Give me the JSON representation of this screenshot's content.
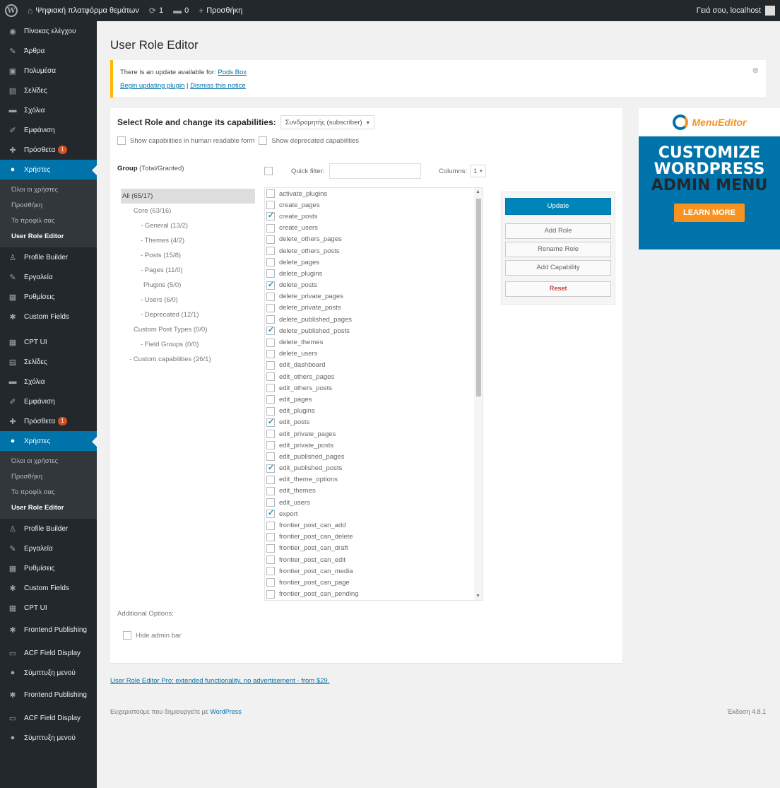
{
  "admin_bar": {
    "site_name": "Ψηφιακή πλατφόρμα θεμάτων",
    "updates_count": "1",
    "comments_count": "0",
    "new_label": "Προσθήκη",
    "howdy": "Γειά σου, localhost"
  },
  "sidebar": {
    "items": [
      {
        "icon": "dashboard-icon",
        "glyph": "◉",
        "label": "Πίνακας ελέγχου"
      },
      {
        "icon": "pin-icon",
        "glyph": "✎",
        "label": "Άρθρα"
      },
      {
        "icon": "media-icon",
        "glyph": "▣",
        "label": "Πολυμέσα"
      },
      {
        "icon": "pages-icon",
        "glyph": "▤",
        "label": "Σελίδες"
      },
      {
        "icon": "comments-icon",
        "glyph": "▬",
        "label": "Σχόλια"
      },
      {
        "icon": "appearance-icon",
        "glyph": "✐",
        "label": "Εμφάνιση"
      },
      {
        "icon": "plugins-icon",
        "glyph": "✚",
        "label": "Πρόσθετα",
        "badge": "1"
      },
      {
        "icon": "users-icon",
        "glyph": "●",
        "label": "Χρήστες",
        "active": true
      }
    ],
    "sub_items": [
      "Όλοι οι χρήστες",
      "Προσθήκη",
      "Το προφίλ σας",
      "User Role Editor"
    ],
    "items_after": [
      {
        "icon": "profile-builder-icon",
        "glyph": "♙",
        "label": "Profile Builder"
      },
      {
        "icon": "tools-icon",
        "glyph": "✎",
        "label": "Εργαλεία"
      },
      {
        "icon": "settings-icon",
        "glyph": "▦",
        "label": "Ρυθμίσεις"
      },
      {
        "icon": "custom-fields-icon",
        "glyph": "✱",
        "label": "Custom Fields"
      }
    ],
    "items2": [
      {
        "icon": "cpt-ui-icon",
        "glyph": "▦",
        "label": "CPT UI"
      },
      {
        "icon": "pages-icon",
        "glyph": "▤",
        "label": "Σελίδες"
      },
      {
        "icon": "comments-icon",
        "glyph": "▬",
        "label": "Σχόλια"
      },
      {
        "icon": "appearance-icon",
        "glyph": "✐",
        "label": "Εμφάνιση"
      },
      {
        "icon": "plugins-icon",
        "glyph": "✚",
        "label": "Πρόσθετα",
        "badge": "1"
      },
      {
        "icon": "users-icon",
        "glyph": "●",
        "label": "Χρήστες",
        "active": true
      }
    ],
    "sub_items2": [
      "Όλοι οι χρήστες",
      "Προσθήκη",
      "Το προφίλ σας",
      "User Role Editor"
    ],
    "items_after2": [
      {
        "icon": "profile-builder-icon",
        "glyph": "♙",
        "label": "Profile Builder"
      },
      {
        "icon": "tools-icon",
        "glyph": "✎",
        "label": "Εργαλεία"
      },
      {
        "icon": "settings-icon",
        "glyph": "▦",
        "label": "Ρυθμίσεις"
      },
      {
        "icon": "custom-fields-icon",
        "glyph": "✱",
        "label": "Custom Fields"
      },
      {
        "icon": "cpt-ui-icon",
        "glyph": "▦",
        "label": "CPT UI"
      },
      {
        "icon": "frontend-publishing-icon",
        "glyph": "✱",
        "label": "Frontend Publishing",
        "tall": true
      },
      {
        "icon": "acf-display-icon",
        "glyph": "▭",
        "label": "ACF Field Display"
      },
      {
        "icon": "collapse-icon",
        "glyph": "●",
        "label": "Σύμπτυξη μενού"
      },
      {
        "icon": "frontend-publishing-icon",
        "glyph": "✱",
        "label": "Frontend Publishing",
        "tall": true
      },
      {
        "icon": "acf-display-icon",
        "glyph": "▭",
        "label": "ACF Field Display"
      },
      {
        "icon": "collapse-icon",
        "glyph": "●",
        "label": "Σύμπτυξη μενού"
      }
    ]
  },
  "page": {
    "title": "User Role Editor"
  },
  "notice": {
    "text": "There is an update available for:",
    "plugin_link": "Pods Box",
    "begin_link": "Begin updating plugin",
    "separator": " | ",
    "dismiss_link": "Dismiss this notice",
    "close_glyph": "⊗"
  },
  "editor": {
    "role_label": "Select Role and change its capabilities:",
    "role_value": "Συνδρομητής (subscriber)",
    "show_human": "Show capabilities in human readable form",
    "show_deprecated": "Show deprecated capabilities",
    "group_label": "Group",
    "group_sub": "(Total/Granted)",
    "quick_filter": "Quick filter:",
    "columns_label": "Columns:",
    "columns_value": "1",
    "tree": [
      {
        "label": "All (65/17)",
        "indent": 0,
        "selected": true
      },
      {
        "label": "Core (63/16)",
        "indent": 16
      },
      {
        "label": "- General (13/2)",
        "indent": 26
      },
      {
        "label": "- Themes (4/2)",
        "indent": 26
      },
      {
        "label": "- Posts (15/8)",
        "indent": 26
      },
      {
        "label": "- Pages (11/0)",
        "indent": 26
      },
      {
        "label": "Plugins (5/0)",
        "indent": 30
      },
      {
        "label": "- Users (6/0)",
        "indent": 26
      },
      {
        "label": "- Deprecated (12/1)",
        "indent": 26
      },
      {
        "label": "Custom Post Types (0/0)",
        "indent": 16
      },
      {
        "label": "- Field Groups (0/0)",
        "indent": 26
      },
      {
        "label": "- Custom capabilities (26/1)",
        "indent": 10
      }
    ],
    "caps": [
      {
        "name": "activate_plugins",
        "checked": false
      },
      {
        "name": "create_pages",
        "checked": false
      },
      {
        "name": "create_posts",
        "checked": true
      },
      {
        "name": "create_users",
        "checked": false
      },
      {
        "name": "delete_others_pages",
        "checked": false
      },
      {
        "name": "delete_others_posts",
        "checked": false
      },
      {
        "name": "delete_pages",
        "checked": false
      },
      {
        "name": "delete_plugins",
        "checked": false
      },
      {
        "name": "delete_posts",
        "checked": true
      },
      {
        "name": "delete_private_pages",
        "checked": false
      },
      {
        "name": "delete_private_posts",
        "checked": false
      },
      {
        "name": "delete_published_pages",
        "checked": false
      },
      {
        "name": "delete_published_posts",
        "checked": true
      },
      {
        "name": "delete_themes",
        "checked": false
      },
      {
        "name": "delete_users",
        "checked": false
      },
      {
        "name": "edit_dashboard",
        "checked": false
      },
      {
        "name": "edit_others_pages",
        "checked": false
      },
      {
        "name": "edit_others_posts",
        "checked": false
      },
      {
        "name": "edit_pages",
        "checked": false
      },
      {
        "name": "edit_plugins",
        "checked": false
      },
      {
        "name": "edit_posts",
        "checked": true
      },
      {
        "name": "edit_private_pages",
        "checked": false
      },
      {
        "name": "edit_private_posts",
        "checked": false
      },
      {
        "name": "edit_published_pages",
        "checked": false
      },
      {
        "name": "edit_published_posts",
        "checked": true
      },
      {
        "name": "edit_theme_options",
        "checked": false
      },
      {
        "name": "edit_themes",
        "checked": false
      },
      {
        "name": "edit_users",
        "checked": false
      },
      {
        "name": "export",
        "checked": true
      },
      {
        "name": "frontier_post_can_add",
        "checked": false
      },
      {
        "name": "frontier_post_can_delete",
        "checked": false
      },
      {
        "name": "frontier_post_can_draft",
        "checked": false
      },
      {
        "name": "frontier_post_can_edit",
        "checked": false
      },
      {
        "name": "frontier_post_can_media",
        "checked": false
      },
      {
        "name": "frontier_post_can_page",
        "checked": false
      },
      {
        "name": "frontier_post_can_pending",
        "checked": false
      }
    ],
    "buttons": {
      "update": "Update",
      "add_role": "Add Role",
      "rename_role": "Rename Role",
      "add_capability": "Add Capability",
      "reset": "Reset"
    },
    "additional_options": "Additional Options:",
    "hide_admin_bar": "Hide admin bar"
  },
  "ad": {
    "logo_text": "MenuEditor",
    "line1": "CUSTOMIZE",
    "line2": "WORDPRESS",
    "line3": "ADMIN MENU",
    "button": "LEARN MORE"
  },
  "footer": {
    "pro_link": "User Role Editor Pro: extended functionality, no advertisement - from $29.",
    "credit_text": "Ευχαριστούμε που δημιουργείτε με",
    "credit_link": "WordPress",
    "version": "Έκδοση 4.8.1"
  },
  "colors": {
    "admin_bar": "#23282d",
    "accent": "#0073aa",
    "notice_border": "#ffb900",
    "ad_orange": "#f7931e"
  }
}
